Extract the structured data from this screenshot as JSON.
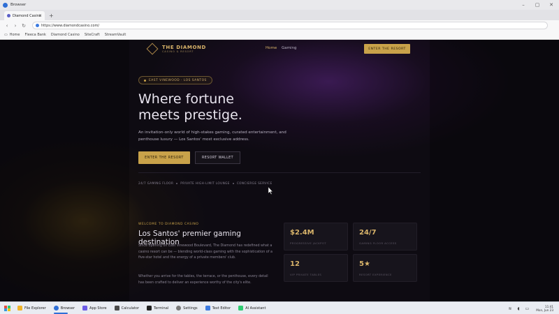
{
  "window": {
    "title": "Browser"
  },
  "tabs": [
    {
      "label": "Diamond Casino"
    }
  ],
  "toolbar": {
    "url": "https://www.diamondcasino.com/"
  },
  "bookmarks": [
    "Home",
    "Fleeca Bank",
    "Diamond Casino",
    "SiteCraft",
    "StreamVault"
  ],
  "site": {
    "logo_title": "THE DIAMOND",
    "logo_subtitle": "CASINO & RESORT",
    "nav": [
      {
        "label": "Home"
      },
      {
        "label": "Gaming"
      }
    ],
    "nav_cta": "ENTER THE RESORT"
  },
  "hero": {
    "badge": "EAST VINEWOOD · LOS SANTOS",
    "title_line1": "Where fortune",
    "title_line2": "meets prestige.",
    "lead": "An invitation-only world of high-stakes gaming, curated entertainment, and penthouse luxury — Los Santos' most exclusive address.",
    "primary_button": "ENTER THE RESORT",
    "secondary_button": "RESORT WALLET",
    "features": [
      "24/7 GAMING FLOOR",
      "PRIVATE HIGH-LIMIT LOUNGE",
      "CONCIERGE SERVICE"
    ]
  },
  "about": {
    "eyebrow": "WELCOME TO DIAMOND CASINO",
    "title": "Los Santos' premier gaming destination",
    "para1": "Since opening on East Vinewood Boulevard, The Diamond has redefined what a casino resort can be — blending world-class gaming with the sophistication of a five-star hotel and the energy of a private members' club.",
    "para2": "Whether you arrive for the tables, the terrace, or the penthouse, every detail has been crafted to deliver an experience worthy of the city's elite."
  },
  "stats": [
    {
      "value": "$2.4M",
      "label": "PROGRESSIVE JACKPOT"
    },
    {
      "value": "24/7",
      "label": "GAMING FLOOR ACCESS"
    },
    {
      "value": "12",
      "label": "VIP PRIVATE TABLES"
    },
    {
      "value": "5★",
      "label": "RESORT EXPERIENCE"
    }
  ],
  "taskbar": {
    "items": [
      {
        "label": "File Explorer",
        "color": "#f0b429"
      },
      {
        "label": "Browser",
        "color": "#2f6fd6"
      },
      {
        "label": "App Store",
        "color": "#6c5ce7"
      },
      {
        "label": "Calculator",
        "color": "#4a4a4a"
      },
      {
        "label": "Terminal",
        "color": "#222222"
      },
      {
        "label": "Settings",
        "color": "#7a7a7a"
      },
      {
        "label": "Text Editor",
        "color": "#3d7be0"
      },
      {
        "label": "AI Assistant",
        "color": "#2ecc71"
      }
    ],
    "time": "11:41",
    "date": "Mon, Jun 23"
  },
  "colors": {
    "gold": "#c9a24a",
    "page_bg": "#0e0b12",
    "purple_glow": "#3a1a52"
  }
}
